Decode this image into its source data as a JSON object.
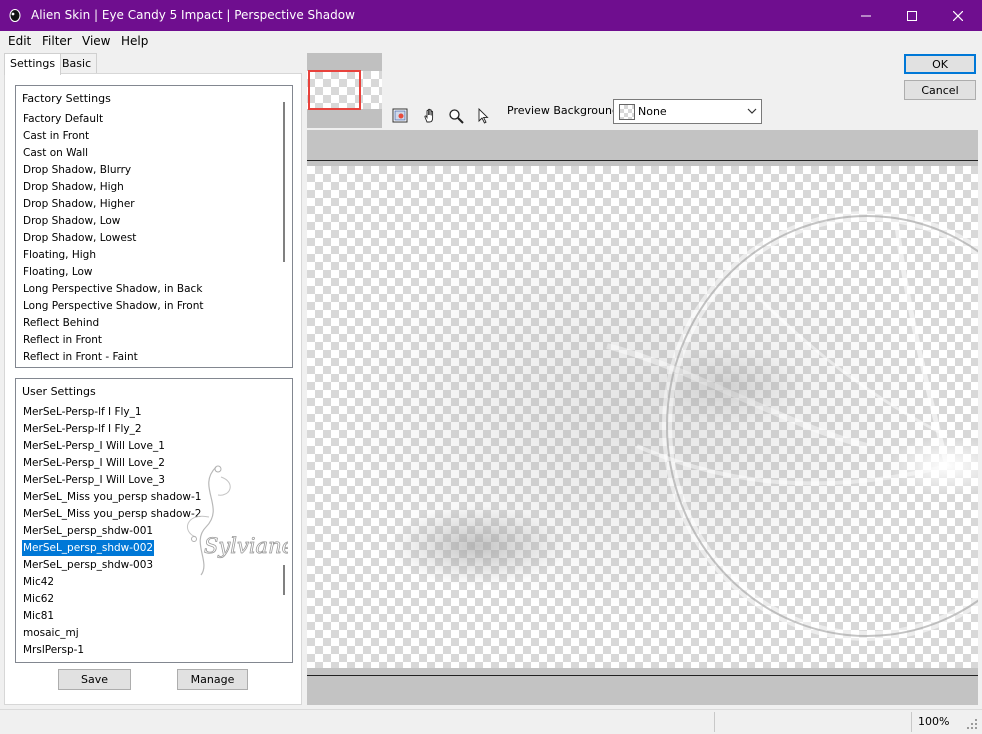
{
  "window": {
    "title": "Alien Skin | Eye Candy 5 Impact | Perspective Shadow",
    "titlebar_color": "#6f0e8f"
  },
  "menu": {
    "edit": "Edit",
    "filter": "Filter",
    "view": "View",
    "help": "Help"
  },
  "tabs": [
    "Settings",
    "Basic"
  ],
  "factory_settings": {
    "header": "Factory Settings",
    "items": [
      "Factory Default",
      "Cast in Front",
      "Cast on Wall",
      "Drop Shadow, Blurry",
      "Drop Shadow, High",
      "Drop Shadow, Higher",
      "Drop Shadow, Low",
      "Drop Shadow, Lowest",
      "Floating, High",
      "Floating, Low",
      "Long Perspective Shadow, in Back",
      "Long Perspective Shadow, in Front",
      "Reflect Behind",
      "Reflect in Front",
      "Reflect in Front - Faint"
    ]
  },
  "user_settings": {
    "header": "User Settings",
    "items": [
      "MerSeL-Persp-lf I Fly_1",
      "MerSeL-Persp-lf I Fly_2",
      "MerSeL-Persp_I Will Love_1",
      "MerSeL-Persp_I Will Love_2",
      "MerSeL-Persp_I Will Love_3",
      "MerSeL_Miss you_persp shadow-1",
      "MerSeL_Miss you_persp shadow-2",
      "MerSeL_persp_shdw-001",
      "MerSeL_persp_shdw-002",
      "MerSeL_persp_shdw-003",
      "Mic42",
      "Mic62",
      "Mic81",
      "mosaic_mj",
      "MrslPersp-1"
    ],
    "selected_item": "MerSeL_persp_shdw-002"
  },
  "buttons": {
    "save": "Save",
    "manage": "Manage",
    "ok": "OK",
    "cancel": "Cancel"
  },
  "preview_background": {
    "label": "Preview Background:",
    "value": "None"
  },
  "watermark": "Sylviane",
  "status": {
    "zoom": "100%"
  },
  "icons": [
    "app-logo-icon",
    "minimize-icon",
    "maximize-icon",
    "close-icon",
    "preview-toggle-icon",
    "hand-icon",
    "zoom-icon",
    "pointer-icon",
    "chevron-down-icon",
    "resize-grip-icon"
  ],
  "colors": {
    "selection": "#0078d7",
    "thumbnail_frame": "#e8423c"
  }
}
